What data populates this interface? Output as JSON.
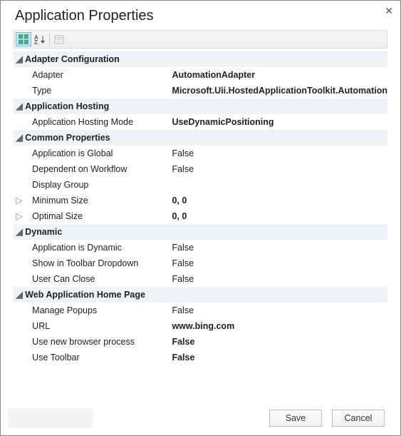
{
  "title": "Application Properties",
  "toolbar": {
    "categorized_tip": "Categorized",
    "alpha_tip": "Alphabetical",
    "pages_tip": "Property Pages"
  },
  "categories": [
    {
      "name": "Adapter Configuration",
      "expanded": true,
      "props": [
        {
          "label": "Adapter",
          "value": "AutomationAdapter",
          "bold": true
        },
        {
          "label": "Type",
          "value": "Microsoft.Uii.HostedApplicationToolkit.Automation",
          "bold": true
        }
      ]
    },
    {
      "name": "Application Hosting",
      "expanded": true,
      "props": [
        {
          "label": "Application Hosting Mode",
          "value": "UseDynamicPositioning",
          "bold": true
        }
      ]
    },
    {
      "name": "Common Properties",
      "expanded": true,
      "props": [
        {
          "label": "Application is Global",
          "value": "False",
          "bold": false
        },
        {
          "label": "Dependent on Workflow",
          "value": "False",
          "bold": false
        },
        {
          "label": "Display Group",
          "value": "",
          "bold": false
        },
        {
          "label": "Minimum Size",
          "value": "0, 0",
          "bold": true,
          "expandable": true
        },
        {
          "label": "Optimal Size",
          "value": "0, 0",
          "bold": true,
          "expandable": true
        }
      ]
    },
    {
      "name": "Dynamic",
      "expanded": true,
      "props": [
        {
          "label": "Application is Dynamic",
          "value": "False",
          "bold": false
        },
        {
          "label": "Show in Toolbar Dropdown",
          "value": "False",
          "bold": false
        },
        {
          "label": "User Can Close",
          "value": "False",
          "bold": false
        }
      ]
    },
    {
      "name": "Web Application Home Page",
      "expanded": true,
      "props": [
        {
          "label": "Manage Popups",
          "value": "False",
          "bold": false
        },
        {
          "label": "URL",
          "value": "www.bing.com",
          "bold": true
        },
        {
          "label": "Use new browser process",
          "value": "False",
          "bold": true
        },
        {
          "label": "Use Toolbar",
          "value": "False",
          "bold": true
        }
      ]
    }
  ],
  "buttons": {
    "save": "Save",
    "cancel": "Cancel"
  }
}
